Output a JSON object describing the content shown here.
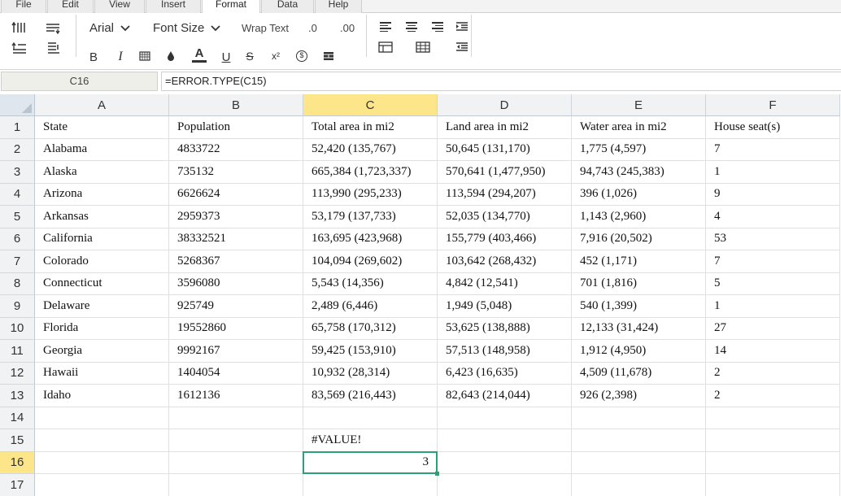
{
  "menu": {
    "tabs": [
      {
        "label": "File",
        "active": false
      },
      {
        "label": "Edit",
        "active": false
      },
      {
        "label": "View",
        "active": false
      },
      {
        "label": "Insert",
        "active": false
      },
      {
        "label": "Format",
        "active": true
      },
      {
        "label": "Data",
        "active": false
      },
      {
        "label": "Help",
        "active": false
      }
    ]
  },
  "toolbar": {
    "font_name": "Arial",
    "font_size": "Font Size",
    "wrap_text": "Wrap Text",
    "decimal_decrease": ".0",
    "decimal_increase": ".00",
    "bold": "B",
    "italic": "I",
    "underline": "U",
    "strikethrough": "S",
    "superscript": "x²",
    "font_color": "A",
    "currency": "$"
  },
  "formula_bar": {
    "cell_ref": "C16",
    "formula": "=ERROR.TYPE(C15)"
  },
  "sheet": {
    "columns": [
      "A",
      "B",
      "C",
      "D",
      "E",
      "F"
    ],
    "selected_column": "C",
    "selected_row": 16,
    "rows": [
      {
        "num": "1",
        "cells": [
          "State",
          "Population",
          "Total area in mi2",
          "Land area in mi2",
          "Water area in mi2",
          "House seat(s)"
        ]
      },
      {
        "num": "2",
        "cells": [
          "Alabama",
          "4833722",
          "52,420 (135,767)",
          "50,645 (131,170)",
          "1,775 (4,597)",
          "7"
        ]
      },
      {
        "num": "3",
        "cells": [
          "Alaska",
          "735132",
          "665,384 (1,723,337)",
          "570,641 (1,477,950)",
          "94,743 (245,383)",
          "1"
        ]
      },
      {
        "num": "4",
        "cells": [
          "Arizona",
          "6626624",
          "113,990 (295,233)",
          "113,594 (294,207)",
          "396 (1,026)",
          "9"
        ]
      },
      {
        "num": "5",
        "cells": [
          "Arkansas",
          "2959373",
          "53,179 (137,733)",
          "52,035 (134,770)",
          "1,143 (2,960)",
          "4"
        ]
      },
      {
        "num": "6",
        "cells": [
          "California",
          "38332521",
          "163,695 (423,968)",
          "155,779 (403,466)",
          "7,916 (20,502)",
          "53"
        ]
      },
      {
        "num": "7",
        "cells": [
          "Colorado",
          "5268367",
          "104,094 (269,602)",
          "103,642 (268,432)",
          "452 (1,171)",
          "7"
        ]
      },
      {
        "num": "8",
        "cells": [
          "Connecticut",
          "3596080",
          "5,543 (14,356)",
          "4,842 (12,541)",
          "701 (1,816)",
          "5"
        ]
      },
      {
        "num": "9",
        "cells": [
          "Delaware",
          "925749",
          "2,489 (6,446)",
          "1,949 (5,048)",
          "540 (1,399)",
          "1"
        ]
      },
      {
        "num": "10",
        "cells": [
          "Florida",
          "19552860",
          "65,758 (170,312)",
          "53,625 (138,888)",
          "12,133 (31,424)",
          "27"
        ]
      },
      {
        "num": "11",
        "cells": [
          "Georgia",
          "9992167",
          "59,425 (153,910)",
          "57,513 (148,958)",
          "1,912 (4,950)",
          "14"
        ]
      },
      {
        "num": "12",
        "cells": [
          "Hawaii",
          "1404054",
          "10,932 (28,314)",
          "6,423 (16,635)",
          "4,509 (11,678)",
          "2"
        ]
      },
      {
        "num": "13",
        "cells": [
          "Idaho",
          "1612136",
          "83,569 (216,443)",
          "82,643 (214,044)",
          "926 (2,398)",
          "2"
        ]
      },
      {
        "num": "14",
        "cells": [
          "",
          "",
          "",
          "",
          "",
          ""
        ]
      },
      {
        "num": "15",
        "cells": [
          "",
          "",
          "#VALUE!",
          "",
          "",
          ""
        ]
      },
      {
        "num": "16",
        "cells": [
          "",
          "",
          "3",
          "",
          "",
          ""
        ]
      },
      {
        "num": "17",
        "cells": [
          "",
          "",
          "",
          "",
          "",
          ""
        ]
      }
    ]
  },
  "colors": {
    "selection_border": "#2aa074",
    "selected_header": "#fde58a"
  }
}
